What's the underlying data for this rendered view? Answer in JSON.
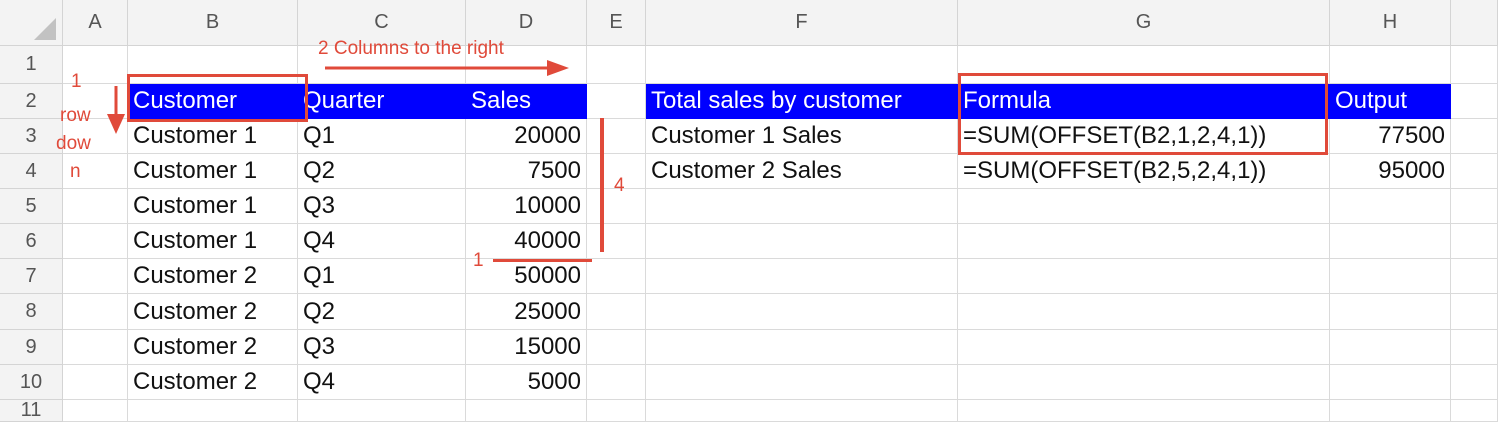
{
  "columns": [
    "A",
    "B",
    "C",
    "D",
    "E",
    "F",
    "G",
    "H"
  ],
  "rows": [
    "1",
    "2",
    "3",
    "4",
    "5",
    "6",
    "7",
    "8",
    "9",
    "10",
    "11"
  ],
  "cells": {
    "B2": "Customer",
    "C2": "Quarter",
    "D2": "Sales",
    "F2": "Total sales by customer",
    "G2": "Formula",
    "H2": "Output",
    "B3": "Customer 1",
    "C3": "Q1",
    "D3": "20000",
    "F3": "Customer 1 Sales",
    "G3": "=SUM(OFFSET(B2,1,2,4,1))",
    "H3": "77500",
    "B4": "Customer 1",
    "C4": "Q2",
    "D4": "7500",
    "F4": "Customer 2 Sales",
    "G4": "=SUM(OFFSET(B2,5,2,4,1))",
    "H4": "95000",
    "B5": "Customer 1",
    "C5": "Q3",
    "D5": "10000",
    "B6": "Customer 1",
    "C6": "Q4",
    "D6": "40000",
    "B7": "Customer 2",
    "C7": "Q1",
    "D7": "50000",
    "B8": "Customer 2",
    "C8": "Q2",
    "D8": "25000",
    "B9": "Customer 2",
    "C9": "Q3",
    "D9": "15000",
    "B10": "Customer 2",
    "C10": "Q4",
    "D10": "5000"
  },
  "annotations": {
    "columns_right": "2 Columns to the right",
    "row_down_lines": [
      "1",
      "row",
      "dow",
      "n"
    ],
    "height_label": "4",
    "width_label": "1"
  },
  "colors": {
    "header_fill": "#0000ff",
    "annotation": "#e04a3a"
  }
}
